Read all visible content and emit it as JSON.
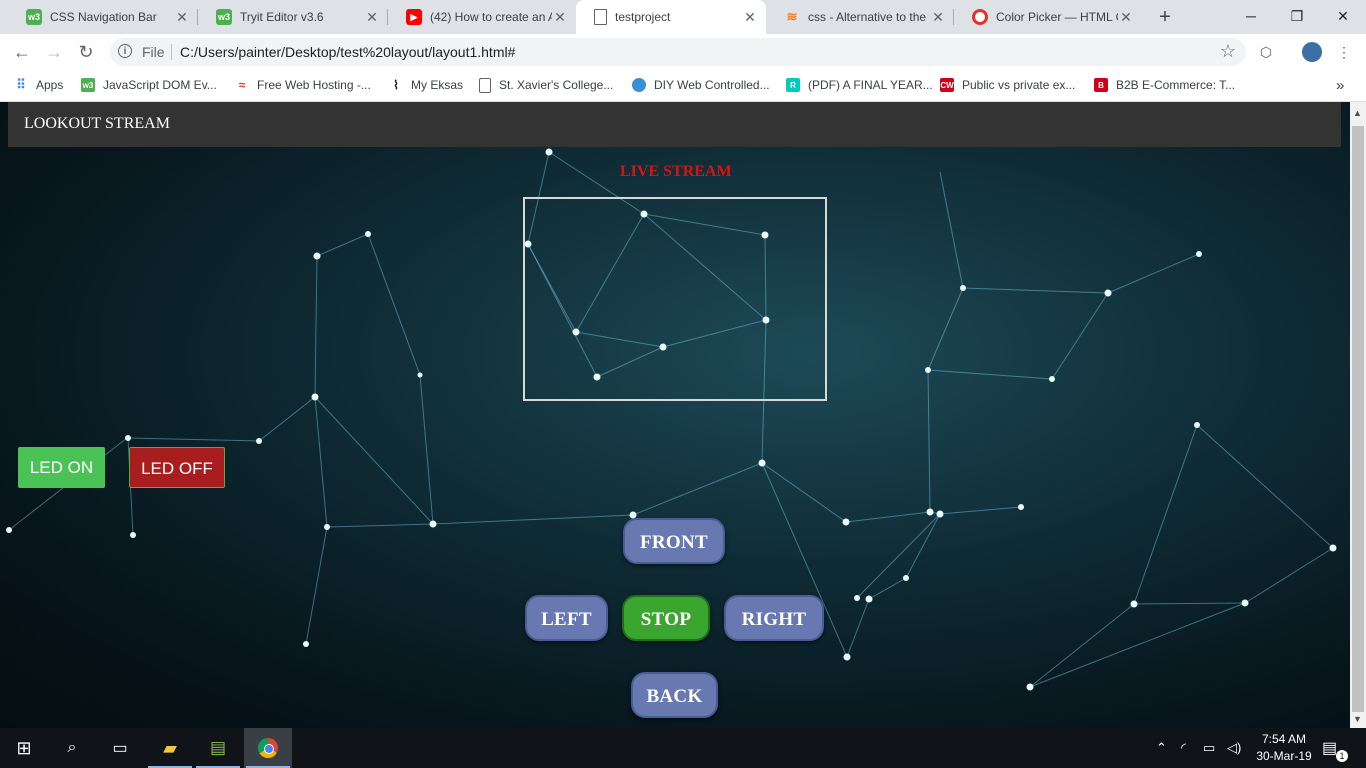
{
  "browser": {
    "tabs": [
      {
        "title": "CSS Navigation Bar",
        "favicon": "w3schools-icon",
        "color": "#4caf50",
        "active": false
      },
      {
        "title": "Tryit Editor v3.6",
        "favicon": "w3schools-icon",
        "color": "#4caf50",
        "active": false
      },
      {
        "title": "(42) How to create an A",
        "favicon": "youtube-icon",
        "color": "#ff0000",
        "active": false
      },
      {
        "title": "testproject",
        "favicon": "document-icon",
        "color": "#5f6368",
        "active": true
      },
      {
        "title": "css - Alternative to the",
        "favicon": "stackoverflow-icon",
        "color": "#f48024",
        "active": false
      },
      {
        "title": "Color Picker — HTML C",
        "favicon": "opera-icon",
        "color": "#e4322b",
        "active": false
      }
    ],
    "address": {
      "scheme_label": "File",
      "url": "C:/Users/painter/Desktop/test%20layout/layout1.html#"
    },
    "bookmarks": [
      {
        "label": "Apps",
        "icon": "apps-grid-icon",
        "color": "#4285f4"
      },
      {
        "label": "JavaScript DOM Ev...",
        "icon": "w3schools-icon",
        "color": "#4caf50"
      },
      {
        "label": "Free Web Hosting -...",
        "icon": "hosting-icon",
        "color": "#e23b2e"
      },
      {
        "label": "My Eksas",
        "icon": "pulse-icon",
        "color": "#202124"
      },
      {
        "label": "St. Xavier's College...",
        "icon": "document-icon",
        "color": "#5f6368"
      },
      {
        "label": "DIY Web Controlled...",
        "icon": "globe-icon",
        "color": "#3a8fd9"
      },
      {
        "label": "(PDF) A FINAL YEAR...",
        "icon": "researchgate-icon",
        "color": "#00ccbb"
      },
      {
        "label": "Public vs private ex...",
        "icon": "codewithc-icon",
        "color": "#d0021b"
      },
      {
        "label": "B2B E-Commerce: T...",
        "icon": "b2b-icon",
        "color": "#d0021b"
      }
    ]
  },
  "page": {
    "brand": "LOOKOUT STREAM",
    "stream_title": "LIVE STREAM",
    "led_on": "LED ON",
    "led_off": "LED OFF",
    "controls": {
      "front": "FRONT",
      "left": "LEFT",
      "stop": "STOP",
      "right": "RIGHT",
      "back": "BACK"
    },
    "colors": {
      "stream_title": "#e01010",
      "led_on": "#4ac256",
      "led_off": "#a81e1e",
      "control": "#6779b0",
      "stop": "#3aa52f",
      "navbar": "#333333"
    }
  },
  "taskbar": {
    "time": "7:54 AM",
    "date": "30-Mar-19",
    "notification_count": "1"
  }
}
